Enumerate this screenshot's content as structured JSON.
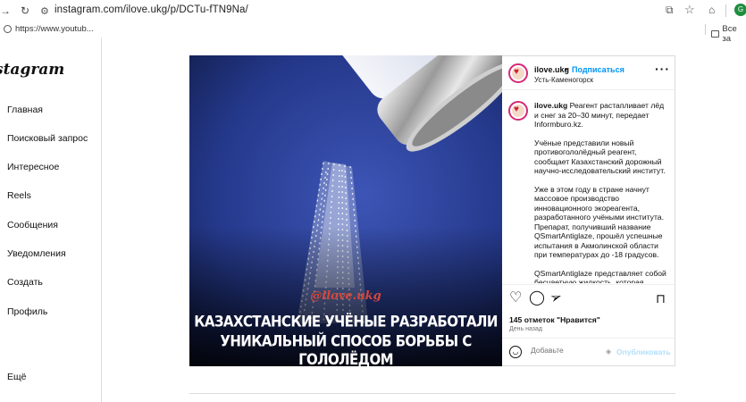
{
  "browser": {
    "url": "instagram.com/ilove.ukg/p/DCTu-fTN9Na/",
    "bookmark": "https://www.youtub...",
    "all_bookmarks": "Все за",
    "profile_initial": "G"
  },
  "sidebar": {
    "logo": "stagram",
    "items": [
      {
        "label": "Главная"
      },
      {
        "label": "Поисковый запрос"
      },
      {
        "label": "Интересное"
      },
      {
        "label": "Reels"
      },
      {
        "label": "Сообщения"
      },
      {
        "label": "Уведомления"
      },
      {
        "label": "Создать"
      },
      {
        "label": "Профиль"
      }
    ],
    "more": "Ещё"
  },
  "post": {
    "watermark": "@ilove.ukg",
    "headline_line1": "КАЗАХСТАНСКИЕ УЧЁНЫЕ РАЗРАБОТАЛИ",
    "headline_line2": "УНИКАЛЬНЫЙ СПОСОБ БОРЬБЫ С ГОЛОЛЁДОМ",
    "username": "ilove.ukg",
    "dot": "•",
    "follow": "Подписаться",
    "location": "Усть-Каменогорск",
    "caption_p1": "Реагент растапливает лёд и снег за 20–30 минут, передает Informburo.kz.",
    "caption_p2": "Учёные представили новый противогололёдный реагент, сообщает Казахстанский дорожный научно-исследовательский институт.",
    "caption_p3": "Уже в этом году в стране начнут массовое производство инновационного экореагента, разработанного учёными института. Препарат, получивший название QSmartAntiglaze, прошёл успешные испытания в Акмолинской области при температурах до -18 градусов.",
    "caption_p4": "QSmartAntiglaze представляет собой бесцветную жидкость, которая",
    "likes": "145 отметок \"Нравится\"",
    "date": "День назад",
    "comment_placeholder": "Добавьте",
    "publish": "Опубликовать"
  }
}
